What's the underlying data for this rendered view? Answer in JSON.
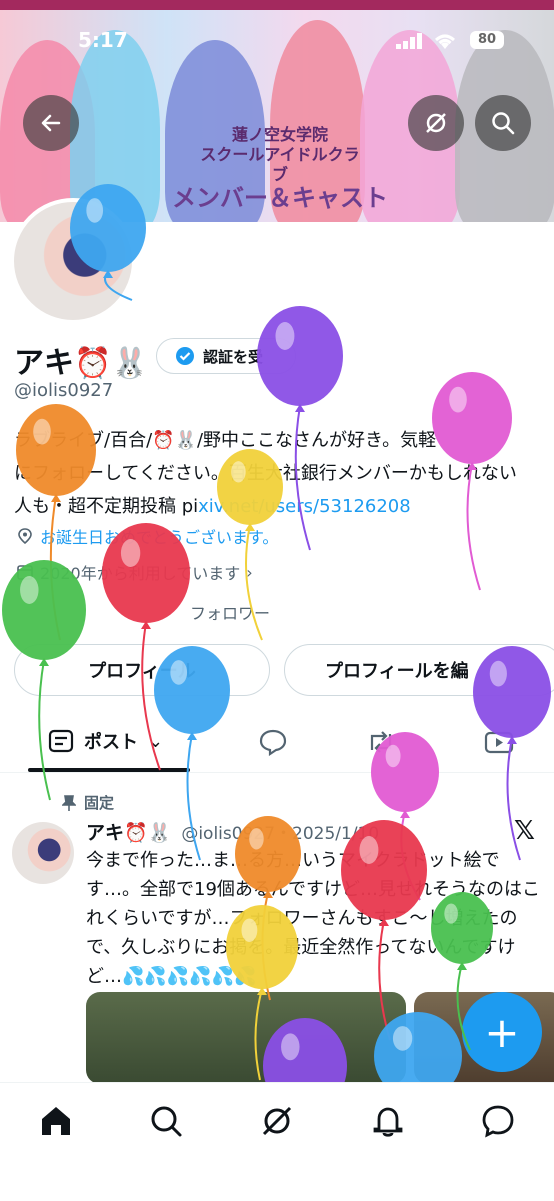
{
  "status": {
    "time": "5:17",
    "battery": "80"
  },
  "banner": {
    "logo_line1": "蓮ノ空女学院",
    "logo_line2": "スクールアイドルクラブ",
    "title": "メンバー＆キャスト"
  },
  "profile": {
    "name": "アキ⏰🐰",
    "handle": "@iolis0927",
    "verify_label": "認証を受",
    "bio_line1": "ラブライブ/百合/⏰🐰/野中ここなさんが好き。気軽",
    "bio_line2": "にフォローしてください。百生大社銀行メンバーかもしれない",
    "bio_line3_prefix": "人も・超不定期投稿 pi",
    "bio_link": "xiv.net/users/53126208",
    "birthday": "お誕生日おめでとうございます。",
    "joined": "2020年から利用しています",
    "followers": "フォロワー"
  },
  "buttons": {
    "left": "プロフィール",
    "right": "プロフィールを編"
  },
  "tabs": {
    "posts": "ポスト"
  },
  "post": {
    "pinned": "固定",
    "author": "アキ⏰🐰",
    "handle": "@iolis0927・2025/1/10",
    "text": "今まで作った…ま…る方…いうマイクラドット絵です…。全部で19個あるんですけど…見せれそうなのはこれくらいですが…フォロワーさんもすこ〜し増えたので、久しぶりにお掲を。最近全然作ってないんですけど…💦💦💦💦💦💦"
  },
  "fab": {
    "label": "+"
  },
  "colors": {
    "accent": "#1d9bf0",
    "text": "#0f1419",
    "muted": "#536471"
  },
  "icons": [
    "back-arrow-icon",
    "grok-icon",
    "search-icon",
    "verified-badge-icon",
    "location-icon",
    "calendar-icon",
    "posts-tab-icon",
    "reply-icon",
    "repost-icon",
    "video-icon",
    "pin-icon",
    "x-logo-icon",
    "home-icon",
    "nav-search-icon",
    "nav-grok-icon",
    "bell-icon",
    "messages-icon"
  ]
}
